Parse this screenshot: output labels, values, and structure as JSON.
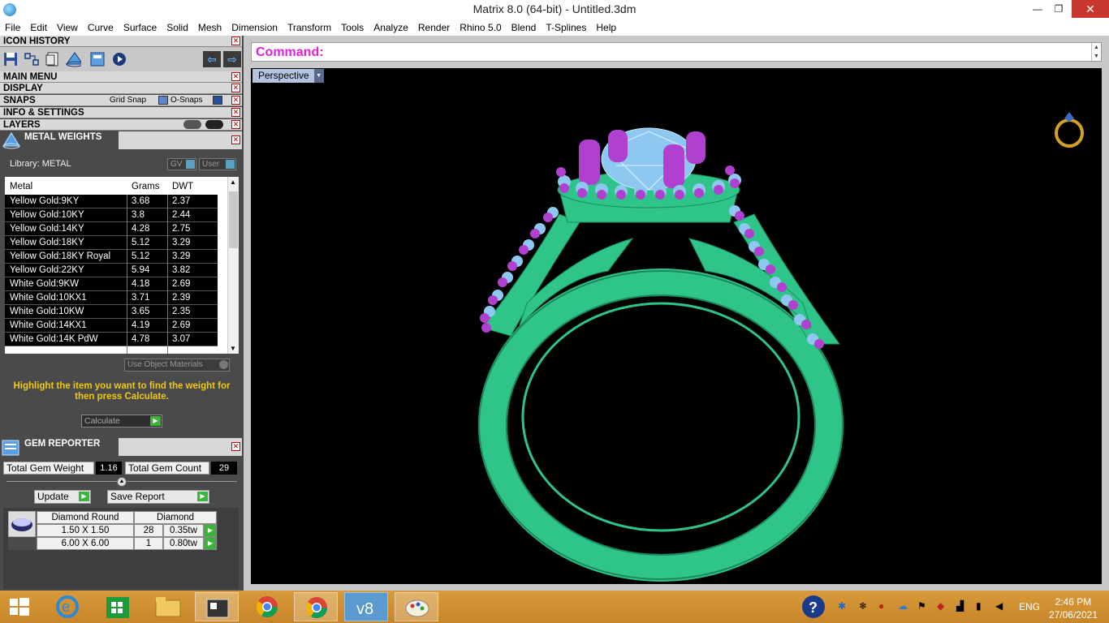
{
  "window": {
    "title": "Matrix 8.0 (64-bit) - Untitled.3dm",
    "controls": {
      "minimize": "—",
      "maximize": "❐",
      "close": "✕"
    }
  },
  "menu": [
    "File",
    "Edit",
    "View",
    "Curve",
    "Surface",
    "Solid",
    "Mesh",
    "Dimension",
    "Transform",
    "Tools",
    "Analyze",
    "Render",
    "Rhino 5.0",
    "Blend",
    "T-Splines",
    "Help"
  ],
  "left_panel": {
    "icon_history": "ICON HISTORY",
    "main_menu": "MAIN MENU",
    "display": "DISPLAY",
    "snaps": {
      "label": "SNAPS",
      "grid_snap": "Grid Snap",
      "osnaps": "O-Snaps"
    },
    "info_settings": "INFO & SETTINGS",
    "layers": "LAYERS",
    "metal_weights": {
      "title": "METAL WEIGHTS",
      "library": "Library: METAL",
      "gv_label": "GV",
      "user_label": "User",
      "columns": [
        "Metal",
        "Grams",
        "DWT"
      ],
      "rows": [
        {
          "metal": "Yellow Gold:9KY",
          "grams": "3.68",
          "dwt": "2.37"
        },
        {
          "metal": "Yellow Gold:10KY",
          "grams": "3.8",
          "dwt": "2.44"
        },
        {
          "metal": "Yellow Gold:14KY",
          "grams": "4.28",
          "dwt": "2.75"
        },
        {
          "metal": "Yellow Gold:18KY",
          "grams": "5.12",
          "dwt": "3.29"
        },
        {
          "metal": "Yellow Gold:18KY Royal",
          "grams": "5.12",
          "dwt": "3.29"
        },
        {
          "metal": "Yellow Gold:22KY",
          "grams": "5.94",
          "dwt": "3.82"
        },
        {
          "metal": "White Gold:9KW",
          "grams": "4.18",
          "dwt": "2.69"
        },
        {
          "metal": "White Gold:10KX1",
          "grams": "3.71",
          "dwt": "2.39"
        },
        {
          "metal": "White Gold:10KW",
          "grams": "3.65",
          "dwt": "2.35"
        },
        {
          "metal": "White Gold:14KX1",
          "grams": "4.19",
          "dwt": "2.69"
        },
        {
          "metal": "White Gold:14K PdW",
          "grams": "4.78",
          "dwt": "3.07"
        }
      ],
      "use_object_materials": "Use Object Materials",
      "hint": "Highlight the item you want to find the weight for then press Calculate.",
      "calculate": "Calculate"
    },
    "gem_reporter": {
      "title": "GEM REPORTER",
      "total_weight_label": "Total Gem Weight",
      "total_weight": "1.16",
      "total_count_label": "Total Gem Count",
      "total_count": "29",
      "update": "Update",
      "save_report": "Save Report",
      "headers": [
        "Diamond Round",
        "Diamond"
      ],
      "rows": [
        {
          "size": "1.50 X 1.50",
          "count": "28",
          "weight": "0.35tw"
        },
        {
          "size": "6.00 X 6.00",
          "count": "1",
          "weight": "0.80tw"
        }
      ]
    }
  },
  "main": {
    "command_label": "Command:",
    "viewport_name": "Perspective"
  },
  "colors": {
    "ring_metal": "#2fc48a",
    "gem_prong": "#b040d0",
    "gem_stone": "#8ec8f0",
    "command": "#e020e0"
  },
  "taskbar": {
    "language": "ENG",
    "time": "2:46 PM",
    "date": "27/06/2021",
    "apps": [
      "start-icon",
      "internet-explorer-icon",
      "store-icon",
      "file-explorer-icon",
      "matrix-app-icon",
      "chrome-icon",
      "chrome-icon-2",
      "vector-app-icon",
      "paint-icon"
    ]
  }
}
